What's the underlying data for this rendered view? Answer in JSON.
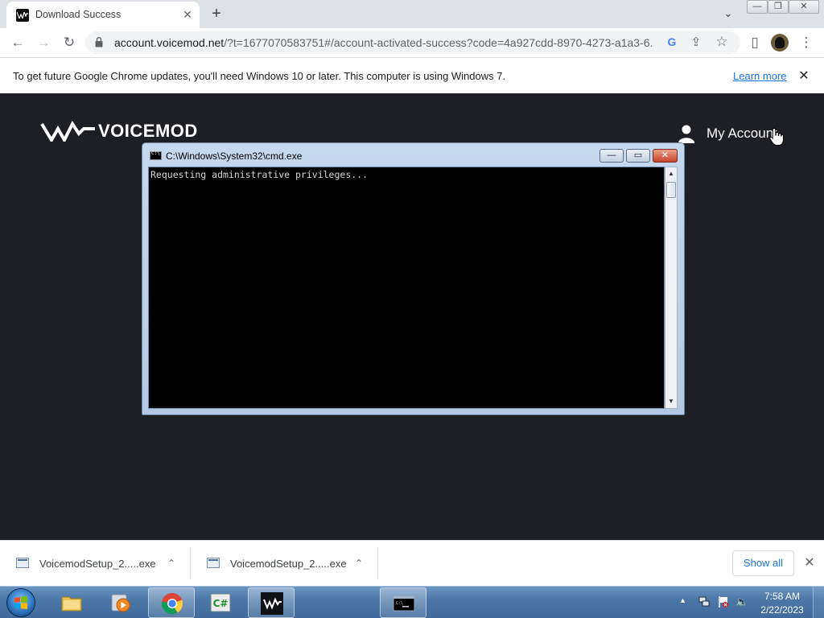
{
  "browser": {
    "tab": {
      "title": "Download Success",
      "close": "✕"
    },
    "new_tab": "+",
    "tab_search": "⌄",
    "window_controls": {
      "minimize": "—",
      "maximize": "❐",
      "close": "✕"
    },
    "toolbar": {
      "back": "←",
      "forward": "→",
      "reload": "↻",
      "url_host": "account.voicemod.net",
      "url_rest": "/?t=1677070583751#/account-activated-success?code=4a927cdd-8970-4273-a1a3-6...",
      "google_icon": "G",
      "share_icon": "⇪",
      "star_icon": "☆",
      "sidepanel_icon": "▯",
      "menu_icon": "⋮"
    },
    "infobar": {
      "message": "To get future Google Chrome updates, you'll need Windows 10 or later. This computer is using Windows 7.",
      "learn_more": "Learn more",
      "close": "✕"
    }
  },
  "page": {
    "logo_text": "VOICEMOD",
    "account_label": "My Account"
  },
  "cmd": {
    "title": "C:\\Windows\\System32\\cmd.exe",
    "icon_text": "C:\\",
    "output": "Requesting administrative privileges...",
    "minimize": "—",
    "maximize": "▭",
    "close": "✕",
    "scroll_up": "▲",
    "scroll_down": "▼"
  },
  "downloads": {
    "items": [
      {
        "name": "VoicemodSetup_2.....exe",
        "chevron": "⌃"
      },
      {
        "name": "VoicemodSetup_2.....exe",
        "chevron": "⌃"
      }
    ],
    "show_all": "Show all",
    "close": "✕"
  },
  "taskbar": {
    "tray_expand": "▲",
    "volume": "🔈",
    "time": "7:58 AM",
    "date": "2/22/2023"
  },
  "colors": {
    "page_bg": "#1e1f24",
    "chrome_tabstrip": "#dee1e6",
    "link": "#1a73e8",
    "taskbar": "#4c78a8"
  },
  "icons": {
    "tab_favicon": "voicemod-icon",
    "lock": "lock-icon",
    "account": "user-icon",
    "cursor": "hand-cursor-icon",
    "download_file": "exe-file-icon"
  }
}
